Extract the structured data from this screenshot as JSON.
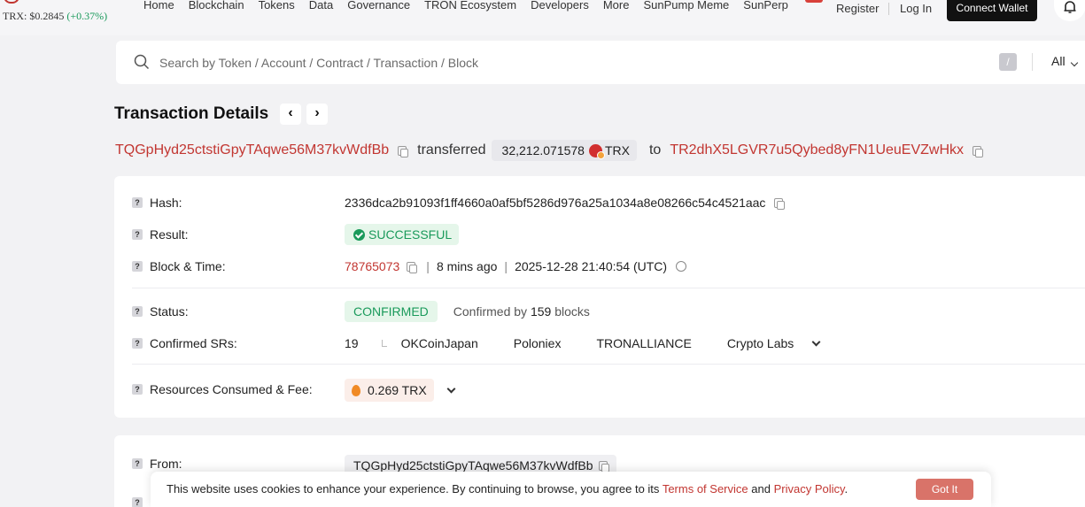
{
  "topbar": {
    "price_label": "TRX: $0.2845",
    "price_change": "(+0.37%)",
    "nav": [
      "Home",
      "Blockchain",
      "Tokens",
      "Data",
      "Governance",
      "TRON Ecosystem",
      "Developers",
      "More",
      "SunPump Meme",
      "SunPerp"
    ],
    "register": "Register",
    "login": "Log In",
    "connect_wallet": "Connect Wallet"
  },
  "search": {
    "placeholder": "Search by Token / Account / Contract / Transaction / Block",
    "shortcut": "/",
    "scope": "All"
  },
  "header": {
    "title": "Transaction Details",
    "prev": "‹",
    "next": "›"
  },
  "summary": {
    "from": "TQGpHyd25ctstiGpyTAqwe56M37kvWdfBb",
    "verb": "transferred",
    "amount": "32,212.071578",
    "token": "TRX",
    "to_word": "to",
    "to": "TR2dhX5LGVR7u5Qybed8yFN1UeuEVZwHkx"
  },
  "details": {
    "hash_label": "Hash:",
    "hash": "2336dca2b91093f1ff4660a0af5bf5286d976a25a1034a8e08266c54c4521aac",
    "result_label": "Result:",
    "result": "SUCCESSFUL",
    "block_label": "Block & Time:",
    "block": "78765073",
    "age": "8 mins ago",
    "timestamp": "2025-12-28 21:40:54 (UTC)",
    "status_label": "Status:",
    "status": "CONFIRMED",
    "confirmed_prefix": "Confirmed by",
    "confirmed_count": "159",
    "confirmed_suffix": "blocks",
    "srs_label": "Confirmed SRs:",
    "srs_count": "19",
    "srs": [
      "OKCoinJapan",
      "Poloniex",
      "TRONALLIANCE",
      "Crypto Labs"
    ],
    "fee_label": "Resources Consumed & Fee:",
    "fee": "0.269 TRX",
    "from_label": "From:",
    "from": "TQGpHyd25ctstiGpyTAqwe56M37kvWdfBb"
  },
  "cookie": {
    "text": "This website uses cookies to enhance your experience. By continuing to browse, you agree to its",
    "terms": "Terms of Service",
    "and": "and",
    "privacy": "Privacy Policy",
    "period": ".",
    "button": "Got It"
  },
  "colors": {
    "brand_red": "#c23631",
    "success_green": "#1a9a5b",
    "page_bg": "#f2f2f4"
  }
}
